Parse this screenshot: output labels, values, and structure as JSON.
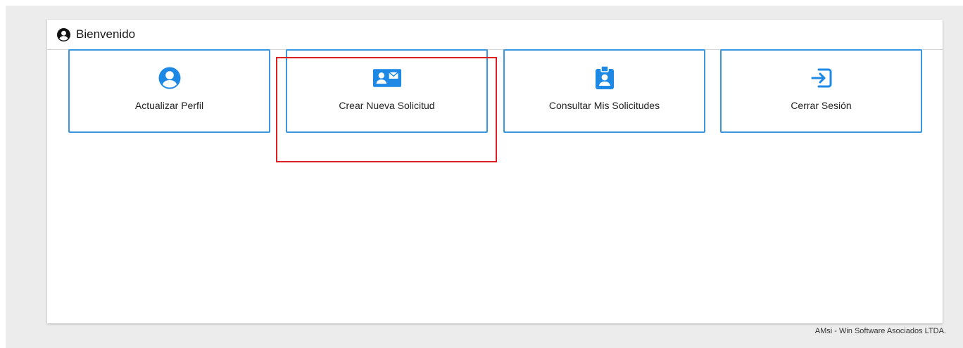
{
  "header": {
    "title": "Bienvenido",
    "icon": "user-circle-icon"
  },
  "tiles": [
    {
      "label": "Actualizar Perfil",
      "icon": "user-circle-icon"
    },
    {
      "label": "Crear Nueva Solicitud",
      "icon": "id-card-envelope-icon"
    },
    {
      "label": "Consultar Mis Solicitudes",
      "icon": "id-badge-icon"
    },
    {
      "label": "Cerrar Sesión",
      "icon": "sign-out-icon"
    }
  ],
  "highlighted_tile": "Crear Nueva Solicitud",
  "footer": {
    "text": "AMsi - Win Software Asociados LTDA."
  },
  "colors": {
    "accent": "#1e88e5",
    "tile_border": "#3a97df",
    "highlight": "#e02020",
    "background": "#ececec"
  }
}
